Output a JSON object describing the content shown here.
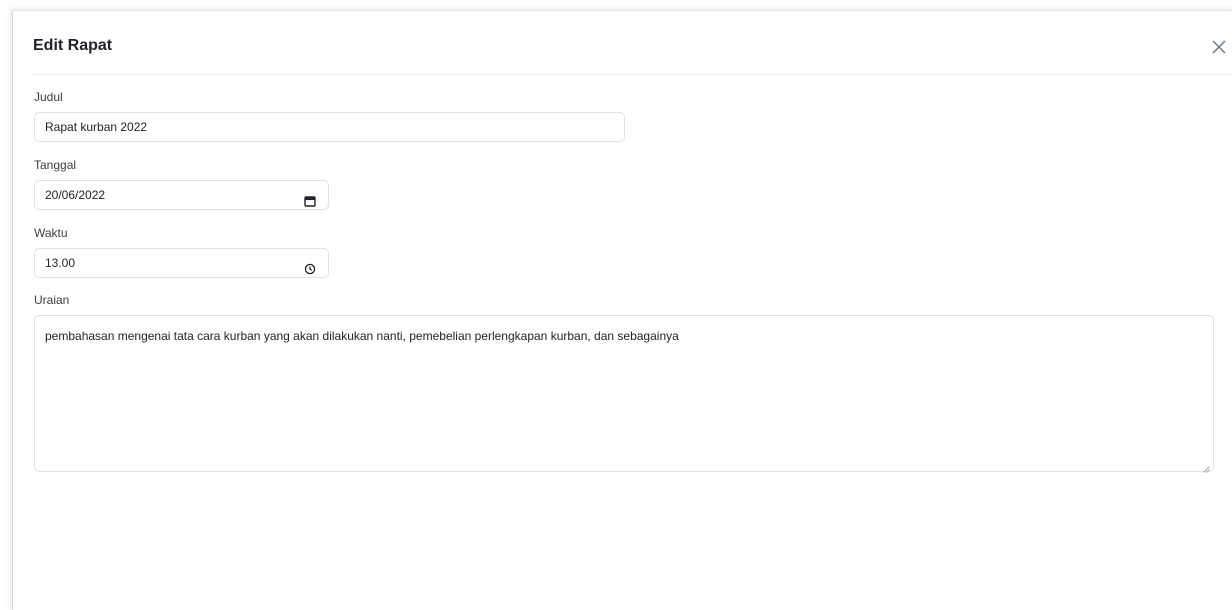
{
  "modal": {
    "title": "Edit Rapat",
    "close_icon": "close-icon"
  },
  "form": {
    "judul": {
      "label": "Judul",
      "value": "Rapat kurban 2022"
    },
    "tanggal": {
      "label": "Tanggal",
      "value": "20/06/2022",
      "icon": "calendar-icon"
    },
    "waktu": {
      "label": "Waktu",
      "value": "13.00",
      "icon": "clock-icon"
    },
    "uraian": {
      "label": "Uraian",
      "value": "pembahasan mengenai tata cara kurban yang akan dilakukan nanti, pemebelian perlengkapan kurban, dan sebagainya"
    }
  }
}
